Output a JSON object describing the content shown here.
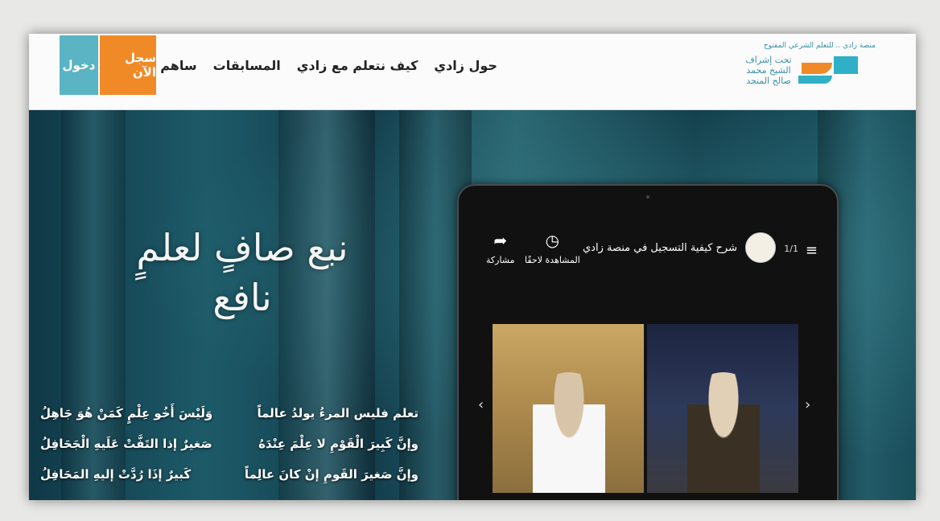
{
  "header": {
    "logo_tagline": "منصة زادي .. للتعلم الشرعي المفتوح",
    "logo_script": "تحت إشراف الشيخ محمد صالح المنجد",
    "nav": [
      "حول زادي",
      "كيف نتعلم مع زادي",
      "المسابقات",
      "ساهم باقتراحك"
    ],
    "register_label": "سجل الآن",
    "login_label": "دخول"
  },
  "hero": {
    "calligraphy": "نبع صافٍ لعلمٍ نافع",
    "poem": [
      [
        "تعلم فليس المرءُ يولدُ عالماً",
        "وَلَيْسَ أَخُو عِلْمٍ كَمَنْ هُوَ جَاهِلُ"
      ],
      [
        "وإنَّ كَبِيرَ الْقَوْمِ لا عِلْمَ عِنْدَهُ",
        "صَغيرٌ إذا التَفَّتْ عَلَيهِ الْجَحَافِلُ"
      ],
      [
        "وإنَّ صَغيرَ القَومِ إنْ كانَ عالِماً",
        "كَبيرٌ إذَا رُدَّتْ إليهِ المَحَافِلُ"
      ]
    ]
  },
  "video": {
    "playlist_count": "1/1",
    "title": "شرح كيفية التسجيل في منصة زادي",
    "watch_later_label": "المشاهدة لاحقًا",
    "share_label": "مشاركة"
  },
  "colors": {
    "orange": "#f08a27",
    "teal": "#5ab4c4"
  }
}
